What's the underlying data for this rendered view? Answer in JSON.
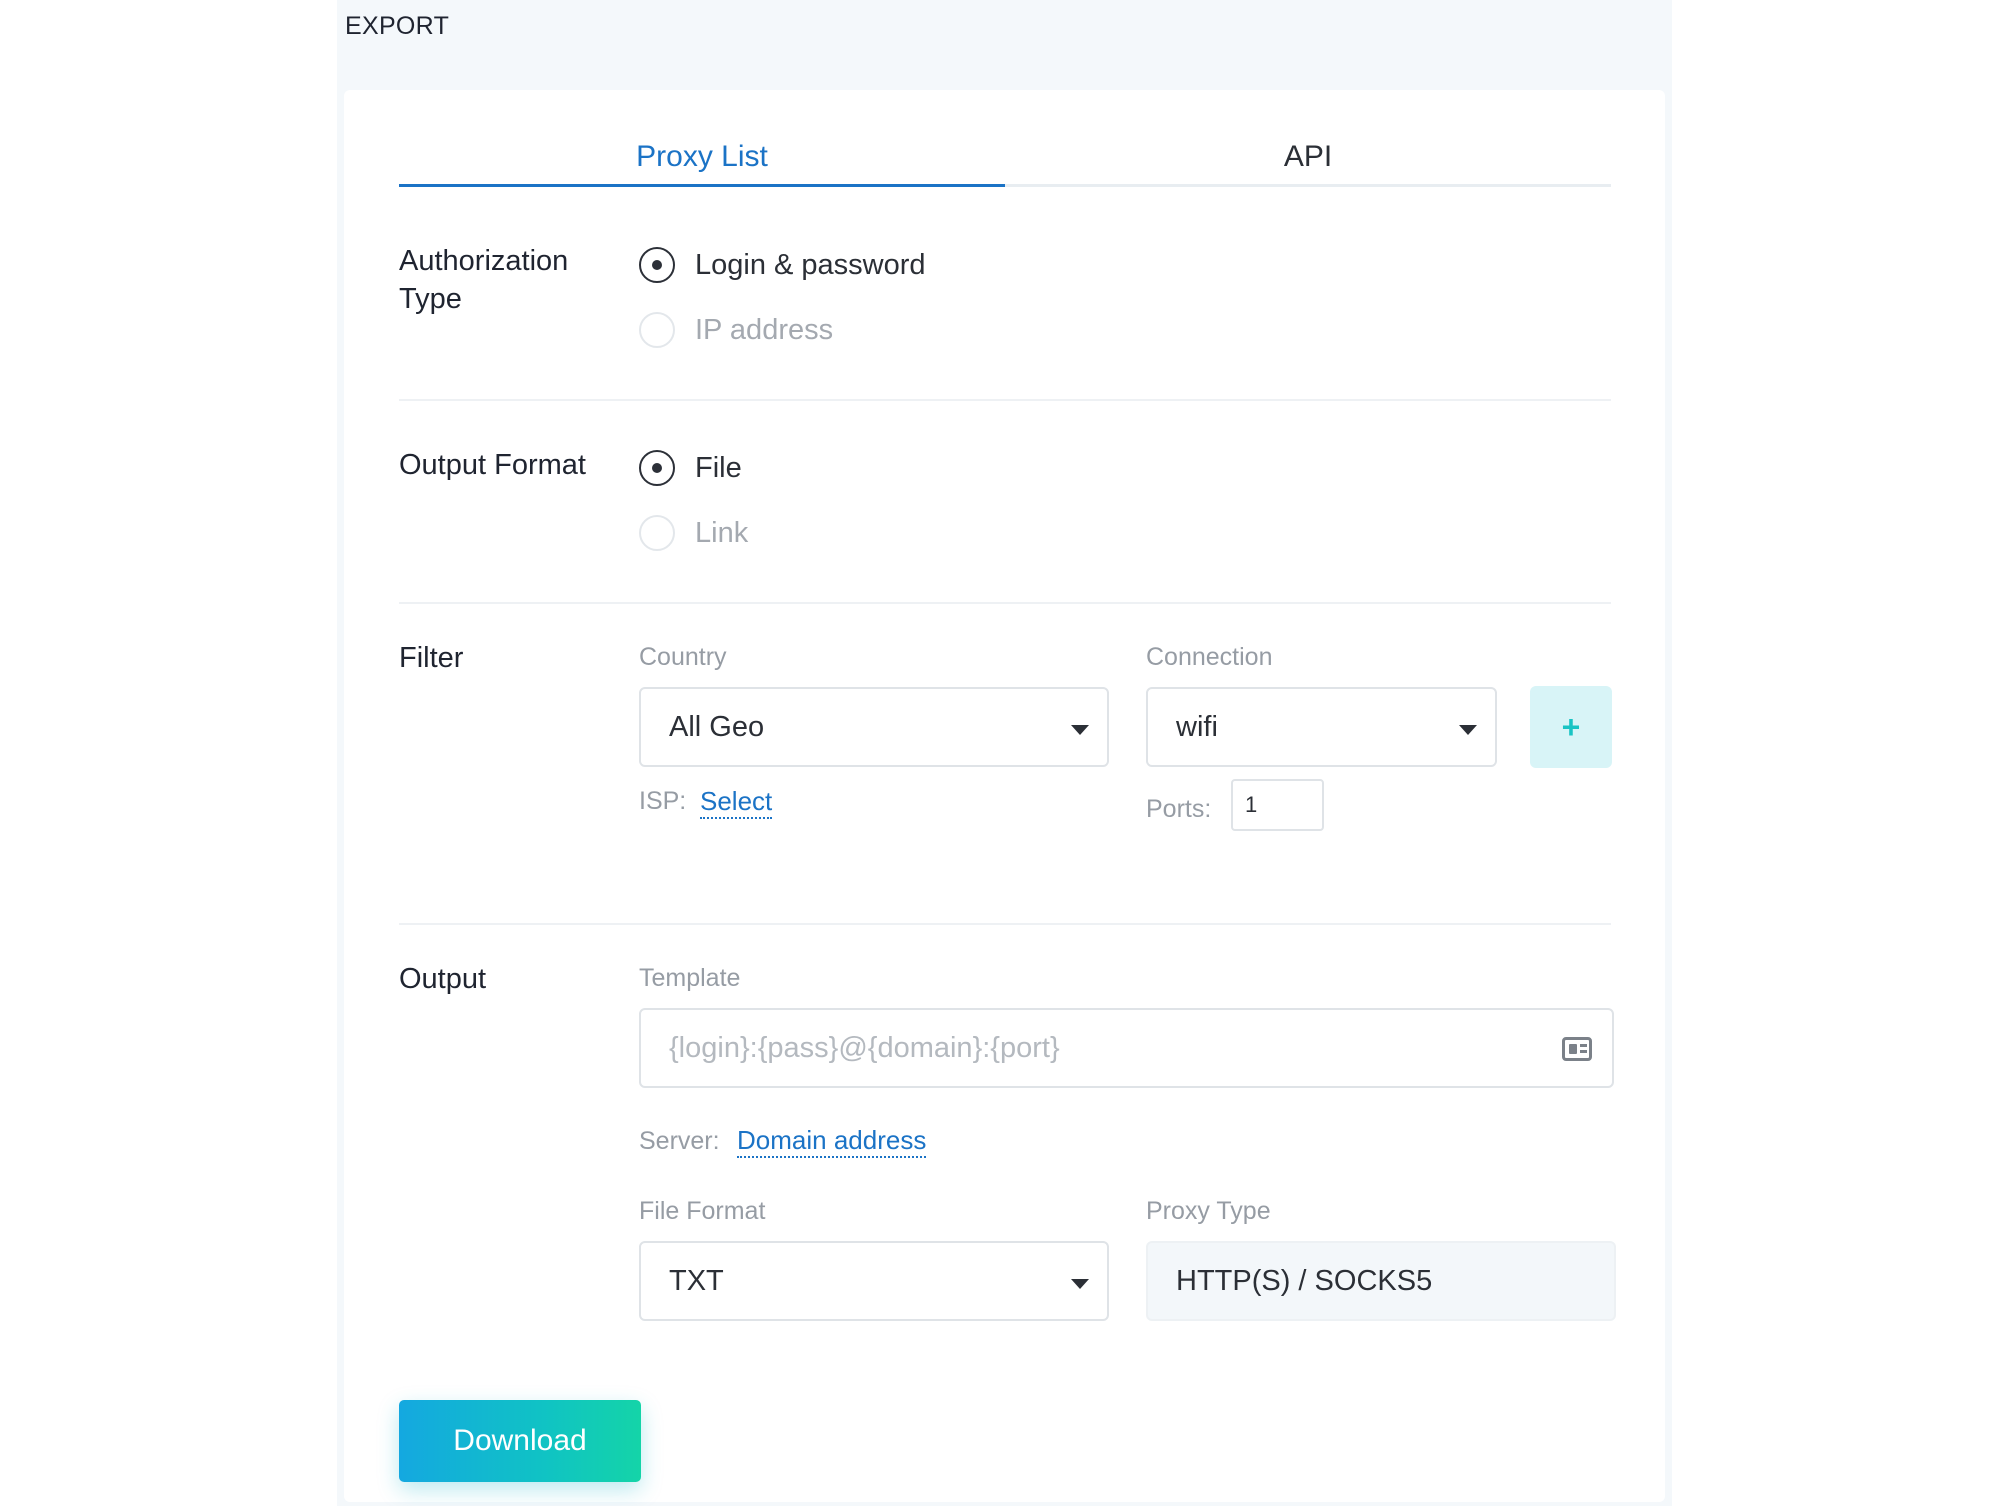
{
  "page": {
    "title": "EXPORT"
  },
  "tabs": [
    {
      "label": "Proxy List",
      "active": true
    },
    {
      "label": "API",
      "active": false
    }
  ],
  "authorization": {
    "label_line1": "Authorization",
    "label_line2": "Type",
    "options": [
      {
        "label": "Login & password",
        "selected": true
      },
      {
        "label": "IP address",
        "selected": false
      }
    ]
  },
  "output_format": {
    "label": "Output Format",
    "options": [
      {
        "label": "File",
        "selected": true
      },
      {
        "label": "Link",
        "selected": false
      }
    ]
  },
  "filter": {
    "label": "Filter",
    "country": {
      "label": "Country",
      "value": "All Geo"
    },
    "connection": {
      "label": "Connection",
      "value": "wifi"
    },
    "add_button": "+",
    "isp": {
      "label": "ISP:",
      "link": "Select"
    },
    "ports": {
      "label": "Ports:",
      "value": "1"
    }
  },
  "output": {
    "label": "Output",
    "template": {
      "label": "Template",
      "placeholder": "{login}:{pass}@{domain}:{port}"
    },
    "server": {
      "label": "Server:",
      "link": "Domain address"
    },
    "file_format": {
      "label": "File Format",
      "value": "TXT"
    },
    "proxy_type": {
      "label": "Proxy Type",
      "value": "HTTP(S) / SOCKS5"
    }
  },
  "actions": {
    "download_label": "Download"
  },
  "colors": {
    "accent": "#1b73c6",
    "teal": "#19c4c4",
    "background": "#f4f8fb"
  }
}
